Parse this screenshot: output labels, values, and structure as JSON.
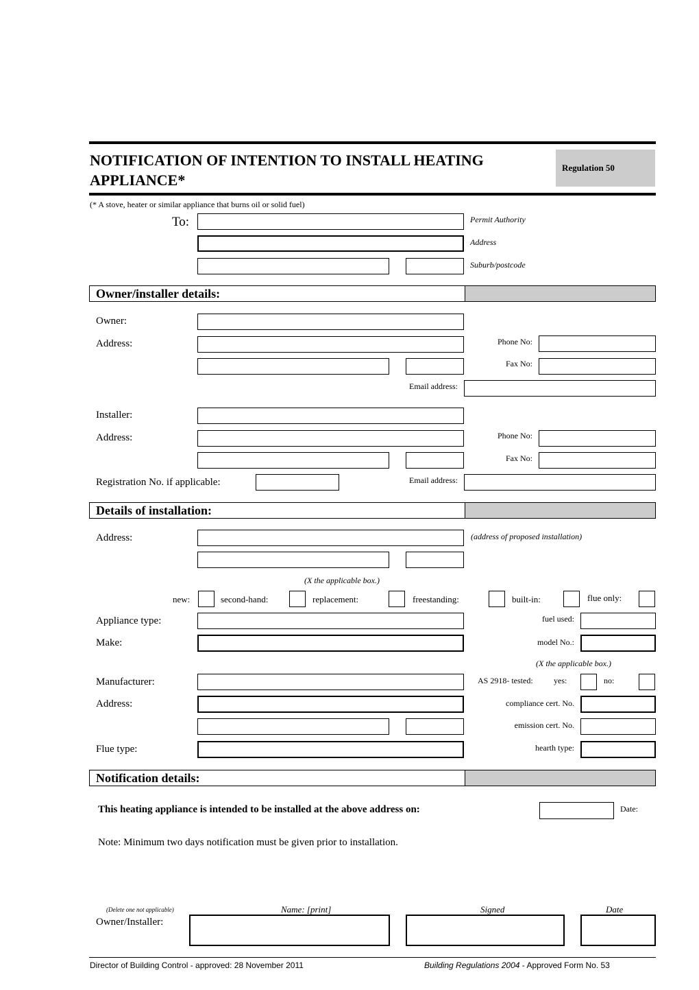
{
  "header": {
    "title": "NOTIFICATION OF INTENTION TO INSTALL HEATING APPLIANCE*",
    "regulation": "Regulation 50",
    "footnote": "(* A stove, heater or similar appliance that burns oil or solid fuel)"
  },
  "to_block": {
    "label": "To:",
    "permit_authority_hint": "Permit Authority",
    "address_hint": "Address",
    "suburb_hint": "Suburb/postcode",
    "permit_authority_value": "",
    "address_value": "",
    "suburb_value": "",
    "postcode_value": ""
  },
  "owner_installer": {
    "section_title": "Owner/installer details:",
    "owner_label": "Owner:",
    "owner_address_label": "Address:",
    "owner_phone_label": "Phone No:",
    "owner_fax_label": "Fax No:",
    "owner_email_label": "Email address:",
    "installer_label": "Installer:",
    "installer_address_label": "Address:",
    "installer_phone_label": "Phone No:",
    "installer_fax_label": "Fax No:",
    "installer_email_label": "Email address:",
    "registration_label": "Registration No. if applicable:"
  },
  "installation": {
    "section_title": "Details of installation:",
    "address_label": "Address:",
    "address_hint": "(address of proposed installation)",
    "checkbox_hint": "(X the applicable box.)",
    "checkboxes": [
      {
        "label": "new:",
        "checked": false
      },
      {
        "label": "second-hand:",
        "checked": false
      },
      {
        "label": "replacement:",
        "checked": false
      },
      {
        "label": "freestanding:",
        "checked": false
      },
      {
        "label": "built-in:",
        "checked": false
      },
      {
        "label": "flue only:",
        "checked": false
      }
    ],
    "appliance_type_label": "Appliance type:",
    "fuel_used_label": "fuel used:",
    "make_label": "Make:",
    "model_label": "model No.:",
    "tested_hint": "(X the applicable box.)",
    "manufacturer_label": "Manufacturer:",
    "as2918_label": "AS 2918- tested:",
    "yes_label": "yes:",
    "no_label": "no:",
    "mfr_address_label": "Address:",
    "compliance_label": "compliance cert. No.",
    "emission_label": "emission cert. No.",
    "flue_type_label": "Flue type:",
    "hearth_type_label": "hearth type:"
  },
  "notification": {
    "section_title": "Notification details:",
    "intent_text": "This heating appliance is intended to be installed at the above address on:",
    "date_label": "Date:",
    "note": "Note: Minimum two days notification must be given prior to installation."
  },
  "signature": {
    "delete_hint": "(Delete one not applicable)",
    "name_header": "Name: [print]",
    "signed_header": "Signed",
    "date_header": "Date",
    "row_label": "Owner/Installer:"
  },
  "footer": {
    "left": "Director of Building Control - approved: 28 November 2011",
    "right_italic": "Building Regulations 2004",
    "right_rest": " - Approved Form No. 53"
  }
}
